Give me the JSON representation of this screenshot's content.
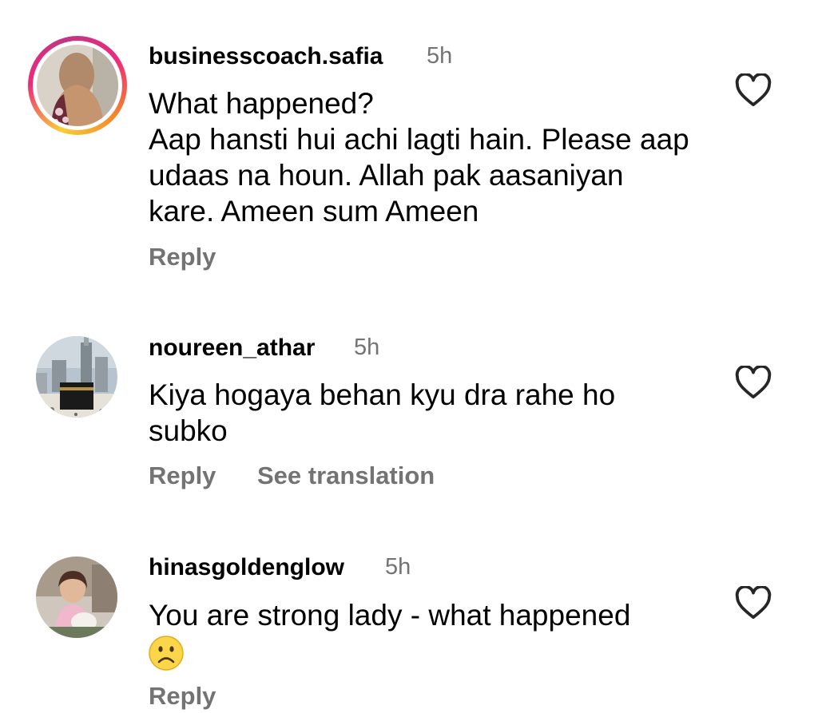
{
  "comments": [
    {
      "username": "businesscoach.safia",
      "time": "5h",
      "text": "What happened?\nAap hansti hui achi lagti hain. Please aap udaas na houn. Allah pak aasaniyan kare.  Ameen sum Ameen",
      "reply_label": "Reply"
    },
    {
      "username": "noureen_athar",
      "time": "5h",
      "text": "Kiya hogaya behan kyu dra rahe ho subko",
      "reply_label": "Reply",
      "translation_label": "See translation"
    },
    {
      "username": "hinasgoldenglow",
      "time": "5h",
      "text": "You are strong lady - what happened",
      "emoji": "frowning-face",
      "reply_label": "Reply"
    }
  ],
  "icons": {
    "like": "heart-outline-icon"
  },
  "colors": {
    "meta_text": "#737373",
    "primary_text": "#000000",
    "story_ring_start": "#f9ce34",
    "story_ring_end": "#ee2a7b"
  }
}
